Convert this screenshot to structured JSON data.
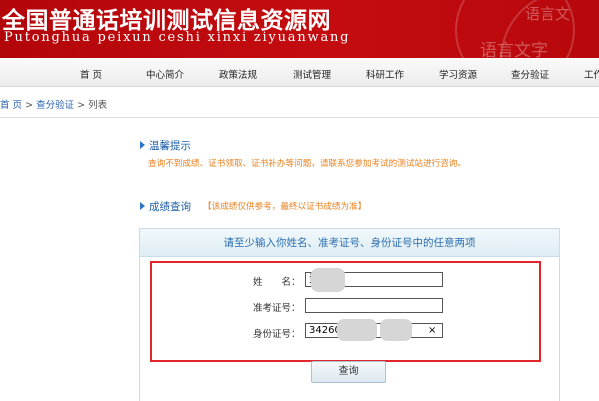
{
  "header": {
    "title": "全国普通话培训测试信息资源网",
    "pinyin": "Putonghua peixun ceshi xinxi ziyuanwang",
    "watermark_top": "语言文",
    "watermark_bottom": "语言文字"
  },
  "nav": {
    "items": [
      "首 页",
      "中心简介",
      "政策法规",
      "测试管理",
      "科研工作",
      "学习资源",
      "查分验证",
      "工作"
    ]
  },
  "breadcrumb": {
    "home": "首 页",
    "sep": ">",
    "section": "查分验证",
    "current": "列表"
  },
  "tips": {
    "title": "温馨提示",
    "text": "查询不到成绩、证书领取、证书补办等问题，请联系您参加考试的测试站进行咨询。"
  },
  "query": {
    "title": "成绩查询",
    "note": "【该成绩仅供参考，最终以证书成绩为准】",
    "form_title": "请至少输入你姓名、准考证号、身份证号中的任意两项",
    "name_label": "姓　　名：",
    "name_value": "资",
    "exam_no_label": "准考证号：",
    "exam_no_value": "",
    "id_label": "身份证号：",
    "id_value": "34260",
    "clear_symbol": "×",
    "submit_label": "查询"
  },
  "colors": {
    "header_red": "#c40c10",
    "link_blue": "#2a62b2",
    "note_orange": "#e9811f",
    "highlight_red": "#e0262b"
  }
}
